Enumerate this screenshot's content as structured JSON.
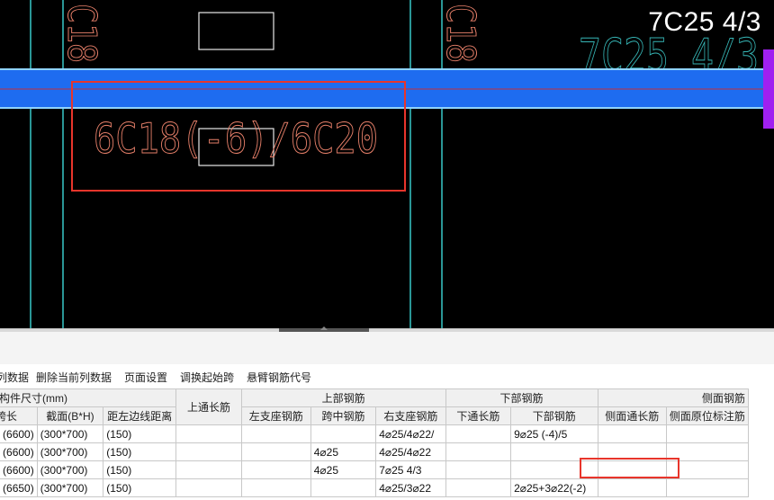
{
  "cad": {
    "hud_label": "7C25 4/3",
    "top_left_text": "C18",
    "top_right_text": "C18",
    "beam_faint_text": "7C25 4/3",
    "annotation_text": "6C18(-6)/6C20",
    "colors": {
      "background": "#000000",
      "beam_fill": "#1e6cf0",
      "beam_edge": "#8fd3ff",
      "column_line": "#38c7c7",
      "rebar_text": "#e8806a",
      "faint_text": "#36b6b6",
      "selection": "#e8352b",
      "side_tab": "#a020f0"
    }
  },
  "toolbar": {
    "items": [
      "列数据",
      "删除当前列数据",
      "页面设置",
      "调换起始跨",
      "悬臂钢筋代号"
    ]
  },
  "table": {
    "group_headers": {
      "dims": "构件尺寸(mm)",
      "top_through": "上通长筋",
      "top_rebar": "上部钢筋",
      "bottom_rebar": "下部钢筋",
      "side_rebar": "侧面钢筋"
    },
    "columns": {
      "span_len": "跨长",
      "section": "截面(B*H)",
      "offset": "距左边线距离",
      "left_support": "左支座钢筋",
      "mid_span": "跨中钢筋",
      "right_support": "右支座钢筋",
      "bottom_through": "下通长筋",
      "bottom": "下部钢筋",
      "side_through": "侧面通长筋",
      "side_web": "侧面原位标注筋"
    },
    "rows": [
      {
        "span_len": "(6600)",
        "section": "(300*700)",
        "offset": "(150)",
        "top_through": "",
        "left_support": "",
        "mid_span": "",
        "right_support": "4⌀25/4⌀22/",
        "bottom_through": "",
        "bottom": "9⌀25 (-4)/5",
        "side_through": "",
        "side_web": ""
      },
      {
        "span_len": "(6600)",
        "section": "(300*700)",
        "offset": "(150)",
        "top_through": "",
        "left_support": "",
        "mid_span": "4⌀25",
        "right_support": "4⌀25/4⌀22",
        "bottom_through": "",
        "bottom": "",
        "side_through": "",
        "side_web": ""
      },
      {
        "span_len": "(6600)",
        "section": "(300*700)",
        "offset": "(150)",
        "top_through": "",
        "left_support": "",
        "mid_span": "4⌀25",
        "right_support": "7⌀25 4/3",
        "bottom_through": "",
        "bottom": "",
        "side_through": "",
        "side_web": ""
      },
      {
        "span_len": "(6650)",
        "section": "(300*700)",
        "offset": "(150)",
        "top_through": "",
        "left_support": "",
        "mid_span": "",
        "right_support": "4⌀25/3⌀22",
        "bottom_through": "",
        "bottom": "2⌀25+3⌀22(-2)",
        "side_through": "",
        "side_web": ""
      }
    ]
  }
}
